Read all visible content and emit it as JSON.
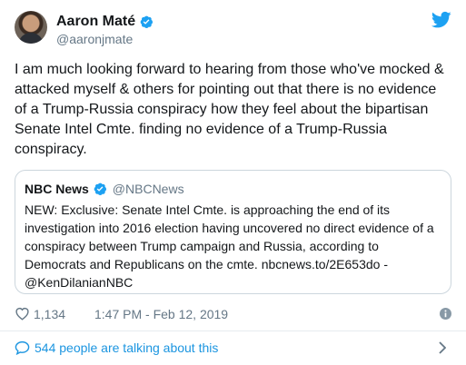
{
  "author": {
    "name": "Aaron Maté",
    "handle": "@aaronjmate"
  },
  "tweet_text": "I am much looking forward to hearing from those who've mocked &\nattacked myself & others for pointing out that there is no evidence\nof a Trump-Russia conspiracy how they feel about the bipartisan\nSenate Intel Cmte. finding no evidence of a Trump-Russia\nconspiracy.",
  "quoted": {
    "name": "NBC News",
    "handle": "@NBCNews",
    "text": "NEW: Exclusive: Senate Intel Cmte. is approaching the end of its\ninvestigation into 2016 election having uncovered no direct evidence of a\nconspiracy between Trump campaign and Russia, according to\nDemocrats and Republicans on the cmte. nbcnews.to/2E653do -\n@KenDilanianNBC"
  },
  "meta": {
    "likes": "1,134",
    "timestamp": "1:47 PM - Feb 12, 2019"
  },
  "footer": {
    "talking": "544 people are talking about this"
  },
  "colors": {
    "accent": "#1da1f2",
    "link": "#1b95e0",
    "muted": "#657786",
    "border": "#ccd6dd"
  },
  "icons": [
    "verified-badge-icon",
    "twitter-bird-icon",
    "heart-icon",
    "info-icon",
    "speech-bubble-icon",
    "chevron-right-icon"
  ]
}
